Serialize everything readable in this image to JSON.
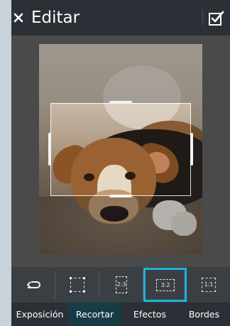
{
  "header": {
    "title": "Editar",
    "close_icon": "close-icon",
    "confirm_icon": "checkbox-confirm-icon"
  },
  "colors": {
    "header_bg": "#2b3036",
    "accent": "#1eb4d8",
    "active_tab_bg": "#183b46",
    "canvas_bg": "#474747"
  },
  "editor": {
    "image_alt": "Photo of a brown and black dog lying on a rug",
    "mode": "crop"
  },
  "crop_tools": [
    {
      "name": "undo",
      "icon": "undo-icon",
      "label": ""
    },
    {
      "name": "free",
      "icon": "crop-free-icon",
      "label": ""
    },
    {
      "name": "2-3",
      "icon": "crop-2-3-icon",
      "label": "2:3"
    },
    {
      "name": "3-2",
      "icon": "crop-3-2-icon",
      "label": "3:2",
      "selected": true
    },
    {
      "name": "1-1",
      "icon": "crop-1-1-icon",
      "label": "1:1"
    }
  ],
  "tabs": [
    {
      "label": "Exposición"
    },
    {
      "label": "Recortar",
      "active": true
    },
    {
      "label": "Efectos"
    },
    {
      "label": "Bordes"
    }
  ]
}
